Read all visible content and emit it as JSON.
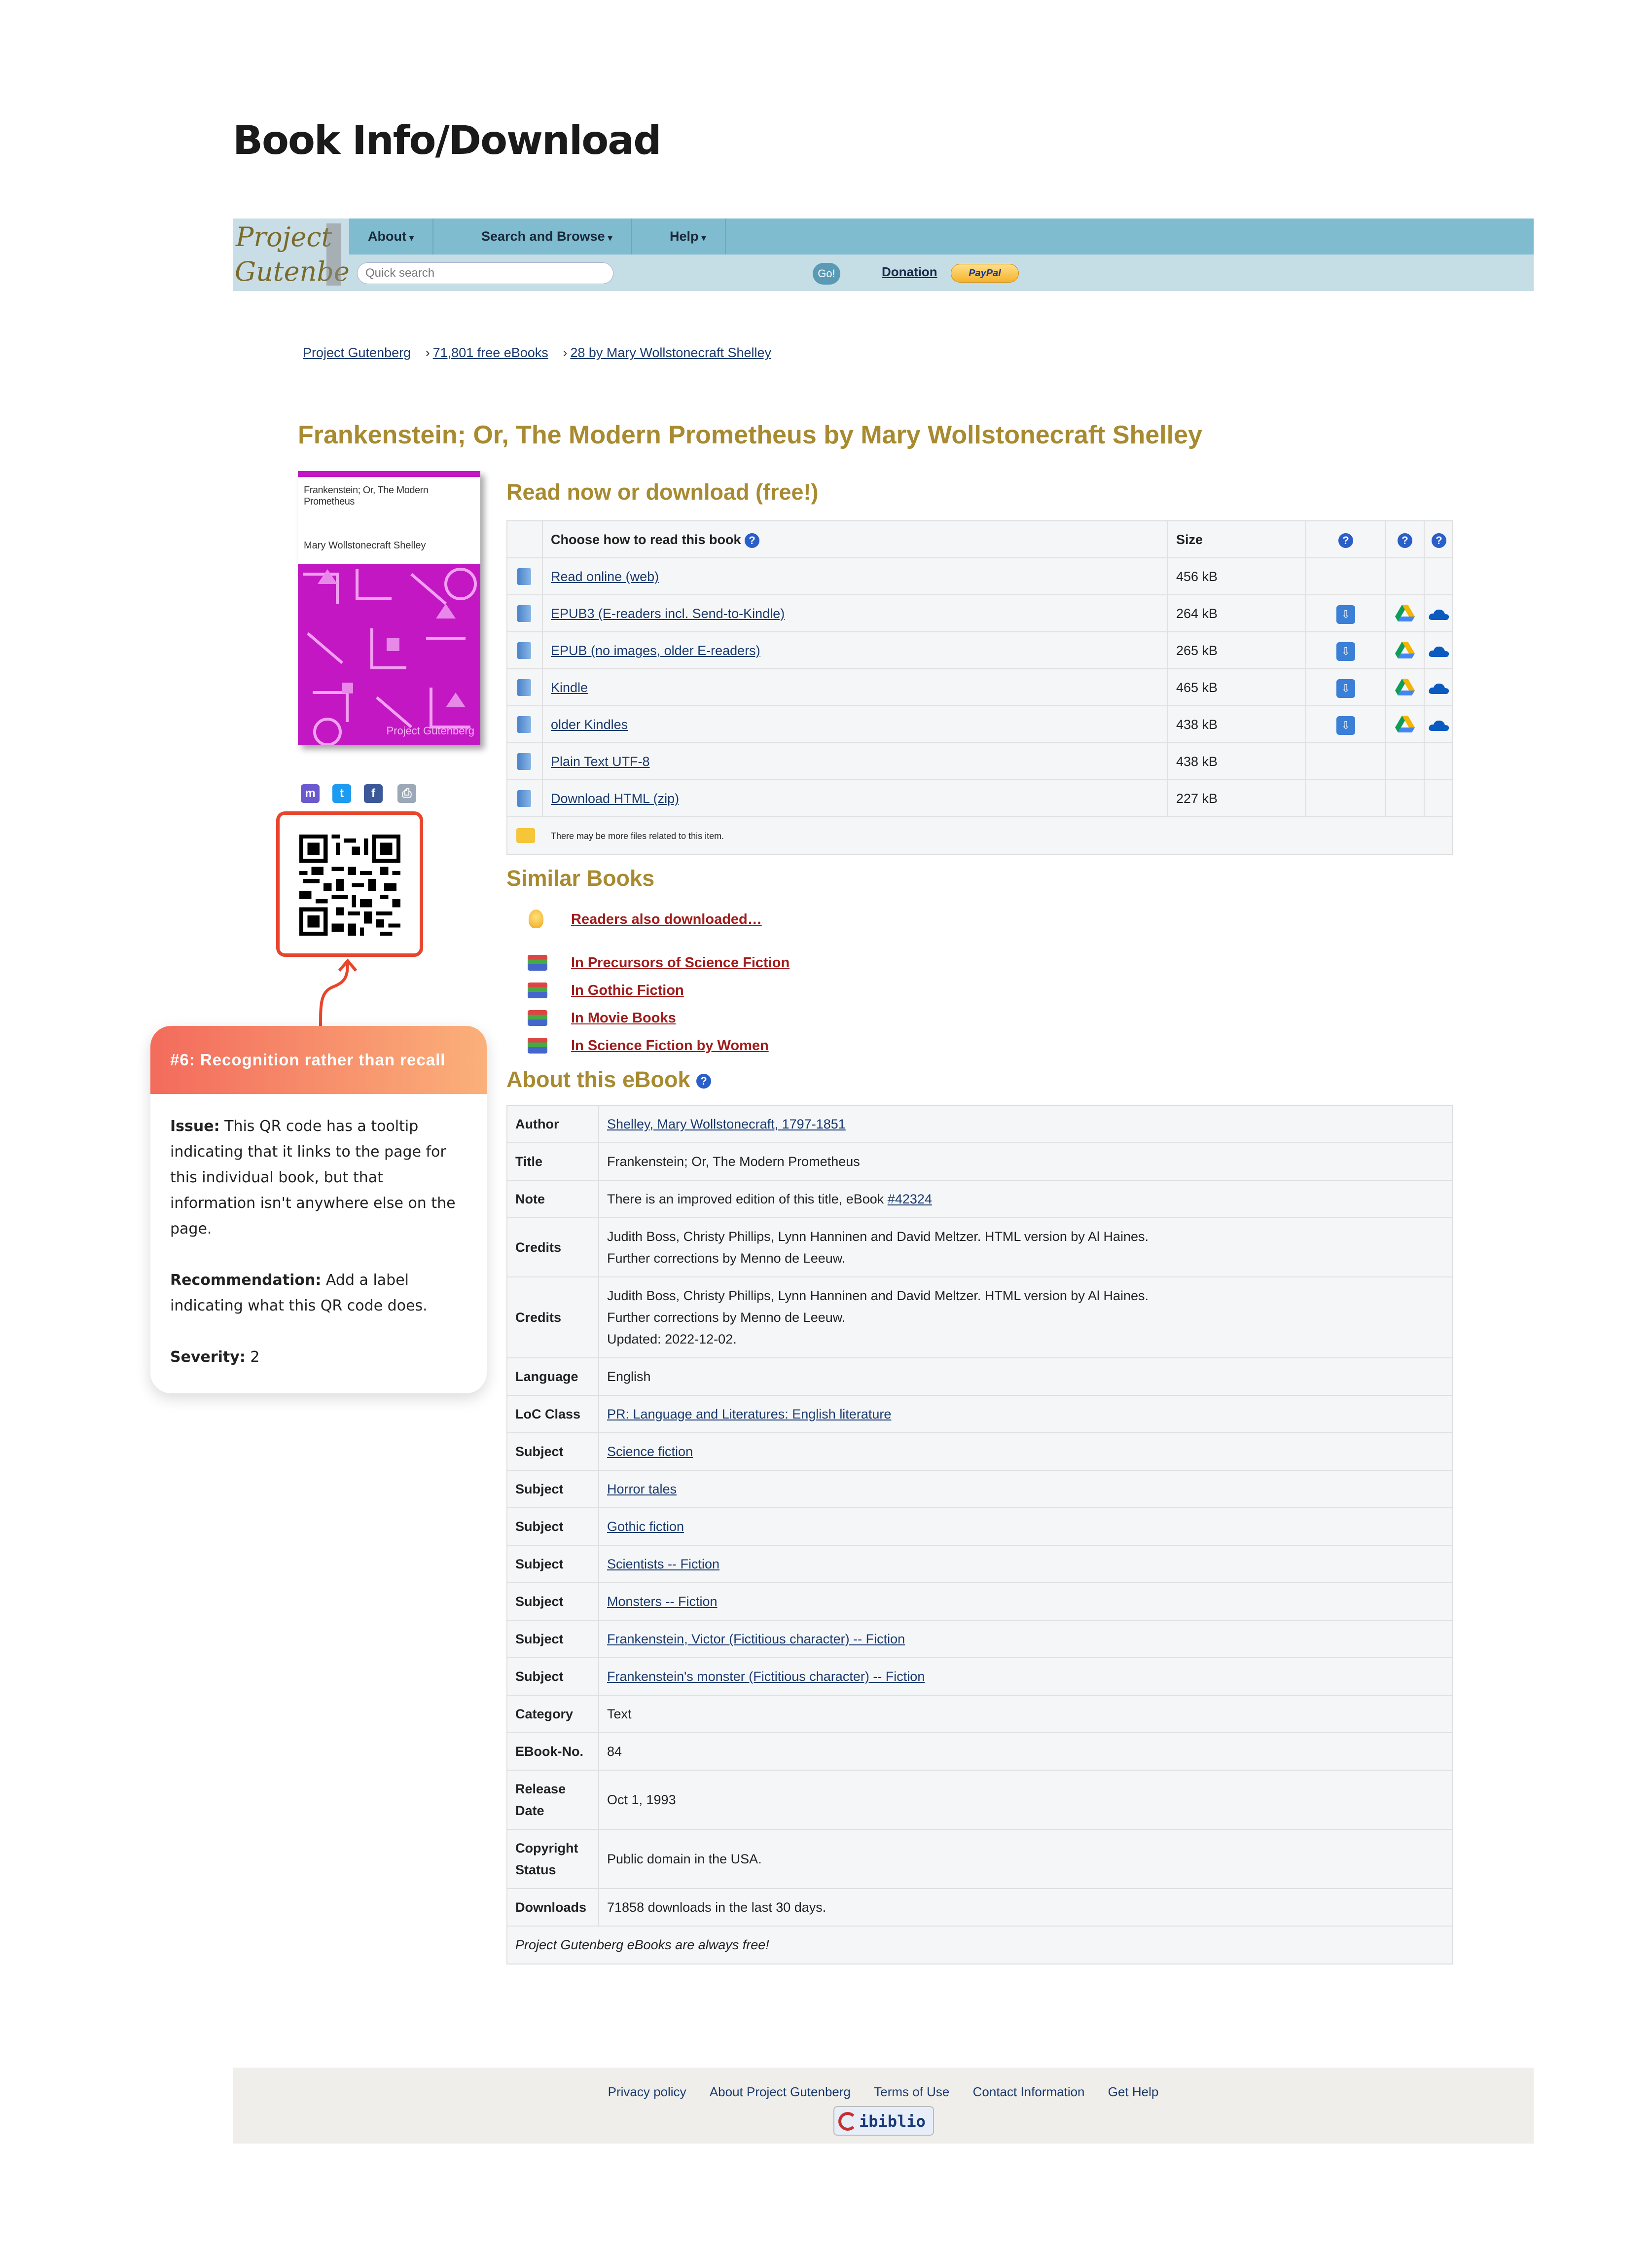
{
  "page_heading": "Book Info/Download",
  "header": {
    "logo_line1": "Project",
    "logo_line2": "Gutenberg",
    "nav": [
      "About",
      "Search and Browse",
      "Help"
    ],
    "search_placeholder": "Quick search",
    "go_label": "Go!",
    "donation_label": "Donation",
    "paypal_label": "PayPal"
  },
  "breadcrumb": {
    "home": "Project Gutenberg",
    "count": "71,801 free eBooks",
    "author": "28 by Mary Wollstonecraft Shelley"
  },
  "book_title": "Frankenstein; Or, The Modern Prometheus by Mary Wollstonecraft Shelley",
  "cover": {
    "title": "Frankenstein; Or, The Modern Prometheus",
    "author": "Mary Wollstonecraft Shelley",
    "publisher": "Project Gutenberg"
  },
  "share_icons": [
    "mastodon-icon",
    "twitter-icon",
    "facebook-icon",
    "print-icon"
  ],
  "issue_card": {
    "header": "#6: Recognition rather than recall",
    "issue_label": "Issue:",
    "issue_text": "This QR code has a tooltip indicating that it links to the page for this individual book, but that information isn't anywhere else on the page.",
    "rec_label": "Recommendation:",
    "rec_text": "Add a label indicating what this QR code does.",
    "severity_label": "Severity:",
    "severity_value": "2"
  },
  "read_section": {
    "heading": "Read now or download (free!)",
    "col_choose": "Choose how to read this book",
    "col_size": "Size",
    "rows": [
      {
        "label": "Read online (web)",
        "size": "456 kB",
        "cloud": false
      },
      {
        "label": "EPUB3 (E-readers incl. Send-to-Kindle)",
        "size": "264 kB",
        "cloud": true
      },
      {
        "label": "EPUB (no images, older E-readers)",
        "size": "265 kB",
        "cloud": true
      },
      {
        "label": "Kindle",
        "size": "465 kB",
        "cloud": true
      },
      {
        "label": "older Kindles",
        "size": "438 kB",
        "cloud": true
      },
      {
        "label": "Plain Text UTF-8",
        "size": "438 kB",
        "cloud": false
      },
      {
        "label": "Download HTML (zip)",
        "size": "227 kB",
        "cloud": false
      }
    ],
    "more_files_note": "There may be more files related to this item."
  },
  "similar_section": {
    "heading": "Similar Books",
    "also_downloaded": "Readers also downloaded…",
    "bookshelves": [
      "In Precursors of Science Fiction",
      "In Gothic Fiction",
      "In Movie Books",
      "In Science Fiction by Women"
    ]
  },
  "about_section": {
    "heading": "About this eBook",
    "rows": [
      {
        "key": "Author",
        "lines": [
          "Shelley, Mary Wollstonecraft, 1797-1851"
        ],
        "link": true
      },
      {
        "key": "Title",
        "lines": [
          "Frankenstein; Or, The Modern Prometheus"
        ],
        "link": false
      },
      {
        "key": "Note",
        "lines": [
          "There is an improved edition of this title, eBook #42324"
        ],
        "link": false
      },
      {
        "key": "Credits",
        "lines": [
          "Judith Boss, Christy Phillips, Lynn Hanninen and David Meltzer. HTML version by Al Haines.",
          "Further corrections by Menno de Leeuw."
        ],
        "link": false
      },
      {
        "key": "Credits",
        "lines": [
          "Judith Boss, Christy Phillips, Lynn Hanninen and David Meltzer. HTML version by Al Haines.",
          "Further corrections by Menno de Leeuw.",
          "Updated: 2022-12-02."
        ],
        "link": false
      },
      {
        "key": "Language",
        "lines": [
          "English"
        ],
        "link": false
      },
      {
        "key": "LoC Class",
        "lines": [
          "PR: Language and Literatures: English literature"
        ],
        "link": true
      },
      {
        "key": "Subject",
        "lines": [
          "Science fiction"
        ],
        "link": true
      },
      {
        "key": "Subject",
        "lines": [
          "Horror tales"
        ],
        "link": true
      },
      {
        "key": "Subject",
        "lines": [
          "Gothic fiction"
        ],
        "link": true
      },
      {
        "key": "Subject",
        "lines": [
          "Scientists -- Fiction"
        ],
        "link": true
      },
      {
        "key": "Subject",
        "lines": [
          "Monsters -- Fiction"
        ],
        "link": true
      },
      {
        "key": "Subject",
        "lines": [
          "Frankenstein, Victor (Fictitious character) -- Fiction"
        ],
        "link": true
      },
      {
        "key": "Subject",
        "lines": [
          "Frankenstein's monster (Fictitious character) -- Fiction"
        ],
        "link": true
      },
      {
        "key": "Category",
        "lines": [
          "Text"
        ],
        "link": false
      },
      {
        "key": "EBook-No.",
        "lines": [
          "84"
        ],
        "link": false
      },
      {
        "key": "Release Date",
        "lines": [
          "Oct 1, 1993"
        ],
        "link": false
      },
      {
        "key": "Copyright Status",
        "lines": [
          "Public domain in the USA."
        ],
        "link": false
      },
      {
        "key": "Downloads",
        "lines": [
          "71858 downloads in the last 30 days."
        ],
        "link": false
      }
    ],
    "free_note": "Project Gutenberg eBooks are always free!"
  },
  "footer": {
    "links": [
      "Privacy policy",
      "About Project Gutenberg",
      "Terms of Use",
      "Contact Information",
      "Get Help"
    ],
    "host_label": "ibiblio"
  }
}
